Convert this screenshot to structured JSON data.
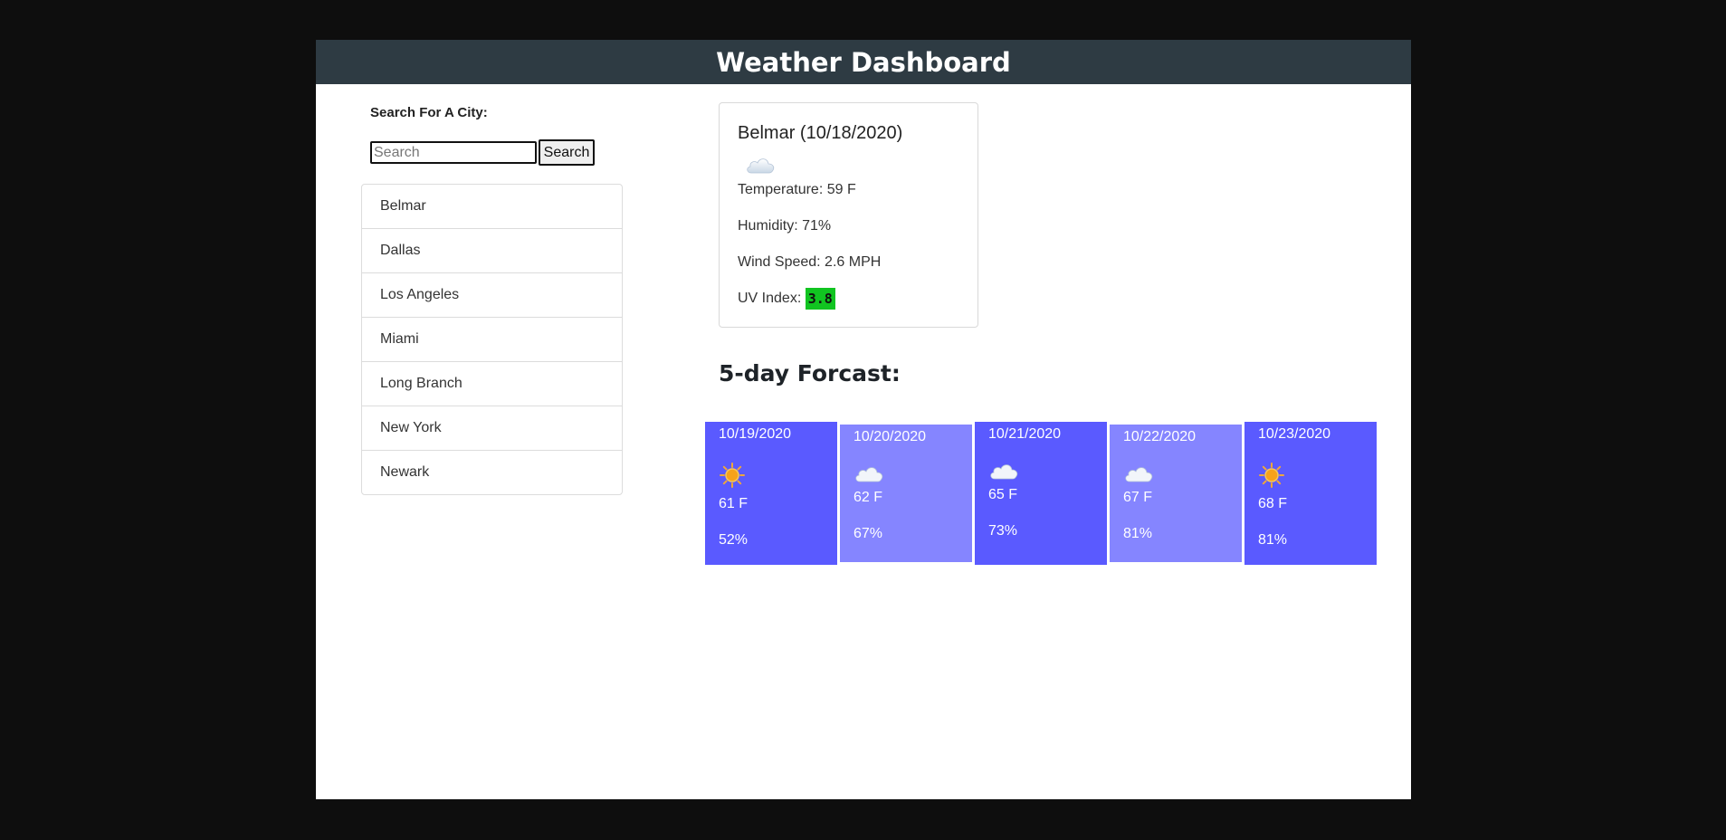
{
  "header": {
    "title": "Weather Dashboard"
  },
  "search": {
    "label": "Search For A City:",
    "placeholder": "Search",
    "value": "",
    "button_label": "Search"
  },
  "cities": [
    "Belmar",
    "Dallas",
    "Los Angeles",
    "Miami",
    "Long Branch",
    "New York",
    "Newark"
  ],
  "current": {
    "title": "Belmar (10/18/2020)",
    "icon": "cloud-icon",
    "temperature": "Temperature: 59 F",
    "humidity": "Humidity: 71%",
    "wind": "Wind Speed: 2.6 MPH",
    "uv_label": "UV Index:",
    "uv_value": "3.8",
    "uv_color": "#11c421"
  },
  "forecast": {
    "title": "5-day Forcast:",
    "days": [
      {
        "date": "10/19/2020",
        "icon": "sun-icon",
        "temp": "61 F",
        "humidity": "52%"
      },
      {
        "date": "10/20/2020",
        "icon": "cloud-icon",
        "temp": "62 F",
        "humidity": "67%"
      },
      {
        "date": "10/21/2020",
        "icon": "cloud-icon",
        "temp": "65 F",
        "humidity": "73%"
      },
      {
        "date": "10/22/2020",
        "icon": "cloud-icon",
        "temp": "67 F",
        "humidity": "81%"
      },
      {
        "date": "10/23/2020",
        "icon": "sun-icon",
        "temp": "68 F",
        "humidity": "81%"
      }
    ]
  },
  "colors": {
    "header": "#2e3b43",
    "card_dark": "#5a5aff",
    "card_light": "#8585ff",
    "background": "#0e0e0e"
  }
}
